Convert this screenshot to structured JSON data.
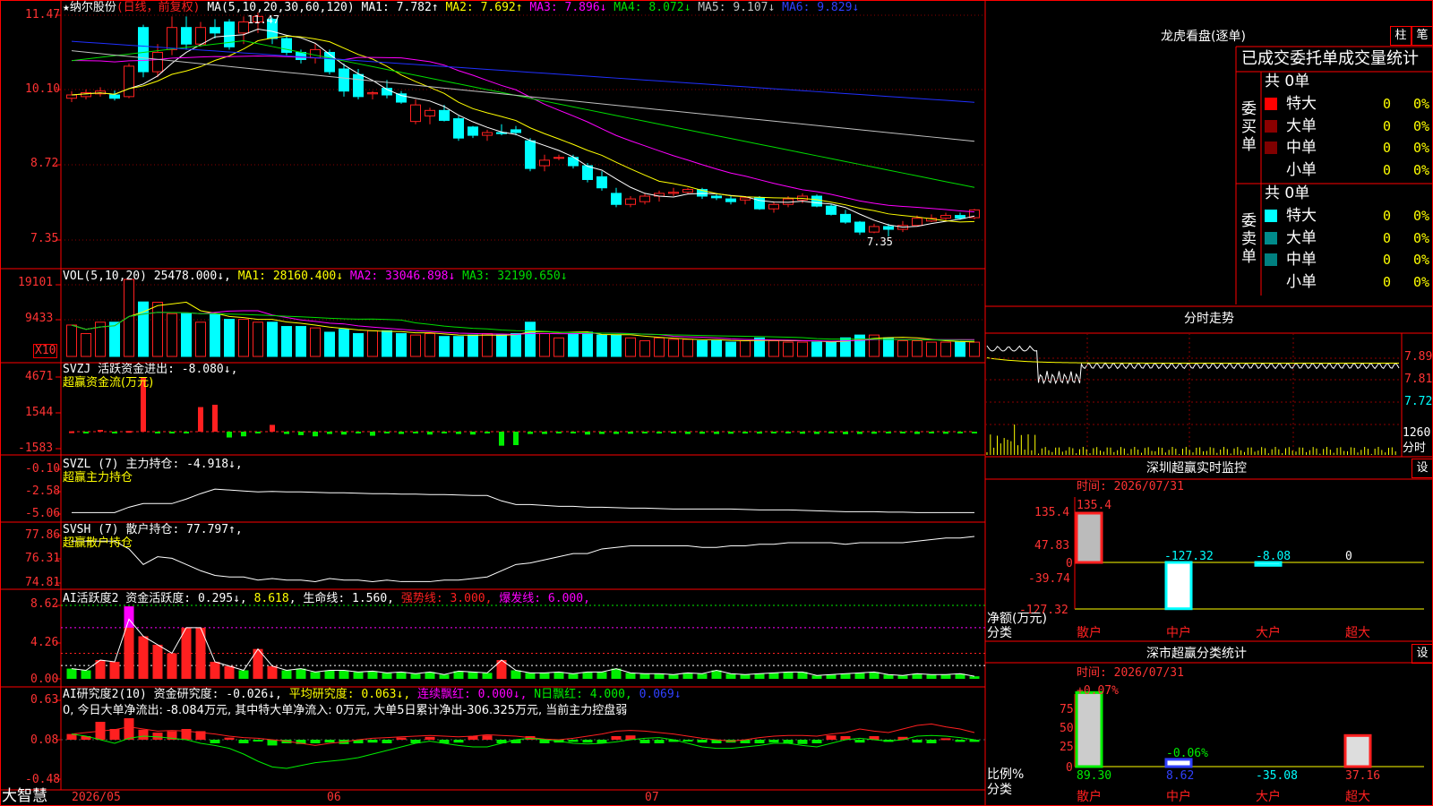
{
  "colors": {
    "up": "#ff2020",
    "down": "#00ffff",
    "ma1": "#ffffff",
    "ma2": "#ffff00",
    "ma3": "#ff00ff",
    "ma4": "#00dd00",
    "ma5": "#c0c0c0",
    "ma6": "#2030ff",
    "grid": "#8b0000",
    "frame": "#ff0000",
    "green": "#00ee00"
  },
  "header": {
    "star": "★",
    "stock_name": "纳尔股份",
    "period": "(日线，前复权)",
    "ma_params": "MA(5,10,20,30,60,120)",
    "ma1": "MA1: 7.782↑",
    "ma2": "MA2: 7.692↑",
    "ma3": "MA3: 7.896↓",
    "ma4": "MA4: 8.072↓",
    "ma5": "MA5: 9.107↓",
    "ma6": "MA6: 9.829↓"
  },
  "price_axis": [
    "11.47",
    "10.10",
    "8.72",
    "7.35"
  ],
  "price_marks": {
    "high": "11.47",
    "low": "7.35"
  },
  "vol": {
    "title": "VOL(5,10,20)",
    "value": "25478.000↓",
    "ma1": "MA1: 28160.400↓",
    "ma2": "MA2: 33046.898↓",
    "ma3": "MA3: 32190.650↓",
    "axis": [
      "19101",
      "9433"
    ],
    "unit": "X10"
  },
  "svzj": {
    "title": "SVZJ  活跃资金进出: -8.080↓,",
    "sub": "超赢资金流(万元)",
    "axis": [
      "4671",
      "1544",
      "-1583"
    ]
  },
  "svzl": {
    "title": "SVZL (7) 主力持仓: -4.918↓,",
    "sub": "超赢主力持仓",
    "axis": [
      "-0.10",
      "-2.58",
      "-5.06"
    ]
  },
  "svsh": {
    "title": "SVSH (7) 散户持仓: 77.797↑,",
    "sub": "超赢散户持仓",
    "axis": [
      "77.86",
      "76.31",
      "74.81"
    ]
  },
  "ai1": {
    "title": "AI活跃度2 资金活跃度: 0.295↓",
    "v2": "8.618",
    "life": "生命线: 1.560,",
    "strong": "强势线: 3.000,",
    "burst": "爆发线: 6.000,",
    "axis": [
      "8.62",
      "4.26",
      "0.00"
    ]
  },
  "ai2": {
    "title": "AI研究度2(10) 资金研究度: -0.026↓,",
    "avg": "平均研究度: 0.063↓,",
    "cont": "连续飘红: 0.000↓,",
    "nday": "N日飘红: 4.000,",
    "last": "0.069↓",
    "summary": "0, 今日大单净流出: -8.084万元, 其中特大单净流入: 0万元, 大单5日累计净出-306.325万元, 当前主力控盘弱",
    "axis": [
      "0.63",
      "0.08",
      "-0.48"
    ]
  },
  "date_axis": {
    "brand": "大智慧",
    "d1": "2026/05",
    "d2": "06",
    "d3": "07"
  },
  "chart_data": {
    "type": "candlestick",
    "title": "纳尔股份 (日线，前复权)",
    "ylim": [
      7.0,
      11.6
    ],
    "labels": {
      "high": 11.47,
      "low": 7.35
    },
    "ohlc": [
      [
        9.92,
        10.05,
        9.85,
        9.98
      ],
      [
        9.95,
        10.08,
        9.9,
        10.02
      ],
      [
        10.0,
        10.12,
        9.95,
        10.05
      ],
      [
        9.98,
        10.06,
        9.88,
        9.92
      ],
      [
        9.95,
        10.55,
        9.92,
        10.5
      ],
      [
        11.2,
        11.25,
        10.3,
        10.4
      ],
      [
        10.4,
        10.9,
        10.3,
        10.75
      ],
      [
        10.8,
        11.4,
        10.7,
        11.2
      ],
      [
        11.2,
        11.4,
        10.8,
        10.9
      ],
      [
        10.9,
        11.3,
        10.85,
        11.2
      ],
      [
        11.2,
        11.35,
        11.0,
        11.1
      ],
      [
        11.3,
        11.35,
        10.8,
        10.85
      ],
      [
        11.1,
        11.4,
        10.9,
        11.3
      ],
      [
        11.3,
        11.47,
        11.1,
        11.4
      ],
      [
        11.35,
        11.38,
        10.9,
        11.0
      ],
      [
        11.0,
        11.05,
        10.7,
        10.75
      ],
      [
        10.75,
        10.8,
        10.55,
        10.62
      ],
      [
        10.65,
        10.9,
        10.55,
        10.8
      ],
      [
        10.75,
        10.8,
        10.35,
        10.4
      ],
      [
        10.45,
        10.55,
        9.95,
        10.05
      ],
      [
        10.35,
        10.45,
        9.9,
        9.95
      ],
      [
        10.0,
        10.05,
        9.9,
        10.02
      ],
      [
        10.1,
        10.25,
        9.92,
        9.98
      ],
      [
        10.0,
        10.05,
        9.82,
        9.85
      ],
      [
        9.5,
        9.9,
        9.45,
        9.8
      ],
      [
        9.6,
        9.75,
        9.45,
        9.7
      ],
      [
        9.7,
        9.8,
        9.5,
        9.52
      ],
      [
        9.55,
        9.6,
        9.15,
        9.2
      ],
      [
        9.4,
        9.42,
        9.2,
        9.25
      ],
      [
        9.25,
        9.35,
        9.15,
        9.3
      ],
      [
        9.3,
        9.45,
        9.25,
        9.28
      ],
      [
        9.35,
        9.42,
        9.25,
        9.3
      ],
      [
        9.15,
        9.2,
        8.6,
        8.65
      ],
      [
        8.7,
        8.9,
        8.6,
        8.8
      ],
      [
        8.85,
        8.9,
        8.8,
        8.85
      ],
      [
        8.85,
        8.9,
        8.65,
        8.7
      ],
      [
        8.7,
        8.75,
        8.4,
        8.45
      ],
      [
        8.5,
        8.6,
        8.25,
        8.3
      ],
      [
        8.2,
        8.3,
        7.95,
        8.0
      ],
      [
        8.0,
        8.15,
        7.95,
        8.1
      ],
      [
        8.05,
        8.2,
        8.0,
        8.15
      ],
      [
        8.15,
        8.25,
        8.05,
        8.2
      ],
      [
        8.2,
        8.3,
        8.15,
        8.22
      ],
      [
        8.22,
        8.3,
        8.18,
        8.27
      ],
      [
        8.27,
        8.3,
        8.1,
        8.15
      ],
      [
        8.15,
        8.2,
        8.08,
        8.12
      ],
      [
        8.1,
        8.15,
        8.0,
        8.05
      ],
      [
        8.08,
        8.15,
        8.0,
        8.12
      ],
      [
        8.12,
        8.15,
        7.9,
        7.92
      ],
      [
        7.92,
        8.05,
        7.85,
        8.0
      ],
      [
        8.0,
        8.15,
        7.95,
        8.1
      ],
      [
        8.08,
        8.2,
        8.02,
        8.15
      ],
      [
        8.15,
        8.18,
        7.95,
        7.97
      ],
      [
        7.97,
        8.0,
        7.8,
        7.82
      ],
      [
        7.82,
        7.9,
        7.65,
        7.68
      ],
      [
        7.68,
        7.7,
        7.45,
        7.5
      ],
      [
        7.5,
        7.65,
        7.48,
        7.6
      ],
      [
        7.6,
        7.65,
        7.42,
        7.55
      ],
      [
        7.55,
        7.7,
        7.5,
        7.62
      ],
      [
        7.62,
        7.8,
        7.6,
        7.75
      ],
      [
        7.7,
        7.82,
        7.68,
        7.75
      ],
      [
        7.75,
        7.85,
        7.7,
        7.8
      ],
      [
        7.8,
        7.85,
        7.72,
        7.75
      ],
      [
        7.76,
        7.92,
        7.73,
        7.9
      ]
    ],
    "vol_x10": [
      11000,
      8000,
      12000,
      12000,
      27000,
      19100,
      19000,
      15000,
      15000,
      12000,
      15000,
      13000,
      13000,
      12000,
      12000,
      10500,
      10500,
      10000,
      8500,
      9500,
      8000,
      9000,
      9000,
      8000,
      7500,
      8000,
      7000,
      7000,
      7500,
      8000,
      7500,
      8000,
      12000,
      8000,
      6500,
      8000,
      8500,
      7500,
      7500,
      6500,
      5500,
      6500,
      6000,
      6000,
      5500,
      5500,
      5000,
      5500,
      6500,
      5500,
      5000,
      5000,
      5000,
      5000,
      6500,
      7500,
      7500,
      6500,
      5500,
      5500,
      5000,
      5000,
      5000,
      5000
    ],
    "fund_flow": [
      30,
      -30,
      150,
      -30,
      60,
      4600,
      -80,
      -30,
      -40,
      2100,
      2300,
      -500,
      -400,
      -150,
      580,
      -200,
      -300,
      -400,
      -200,
      -250,
      -150,
      -350,
      -150,
      -200,
      -150,
      -250,
      -100,
      -200,
      -250,
      -150,
      -1200,
      -1150,
      -200,
      -200,
      -150,
      -150,
      -250,
      -200,
      -200,
      -180,
      -150,
      -160,
      -150,
      -200,
      -180,
      -200,
      -180,
      -160,
      -170,
      -150,
      -150,
      -180,
      -200,
      -150,
      -220,
      -200,
      -180,
      -150,
      -150,
      -200,
      -150,
      -180,
      -150,
      -120
    ],
    "svzl": [
      -4.9,
      -4.9,
      -4.9,
      -4.9,
      -4.3,
      -3.9,
      -3.9,
      -3.9,
      -3.4,
      -2.8,
      -2.3,
      -2.4,
      -2.5,
      -2.6,
      -2.55,
      -2.6,
      -2.6,
      -2.65,
      -2.7,
      -2.7,
      -2.75,
      -2.8,
      -2.8,
      -2.85,
      -2.85,
      -2.9,
      -2.9,
      -2.95,
      -3.0,
      -3.0,
      -3.6,
      -4.0,
      -4.0,
      -4.1,
      -4.2,
      -4.2,
      -4.3,
      -4.3,
      -4.35,
      -4.4,
      -4.4,
      -4.45,
      -4.5,
      -4.5,
      -4.5,
      -4.5,
      -4.5,
      -4.55,
      -4.6,
      -4.6,
      -4.6,
      -4.65,
      -4.7,
      -4.75,
      -4.8,
      -4.8,
      -4.8,
      -4.85,
      -4.85,
      -4.9,
      -4.9,
      -4.9,
      -4.9,
      -4.9
    ],
    "svsh": [
      77.5,
      77.5,
      77.5,
      77.5,
      77.0,
      76.0,
      76.5,
      76.4,
      76.0,
      75.6,
      75.3,
      75.2,
      75.2,
      75.0,
      75.1,
      75.0,
      75.0,
      74.9,
      75.1,
      75.0,
      75.0,
      74.9,
      75.0,
      74.9,
      74.9,
      74.9,
      75.0,
      75.0,
      75.1,
      75.2,
      75.6,
      76.0,
      76.1,
      76.3,
      76.5,
      76.7,
      76.7,
      77.0,
      77.1,
      77.2,
      77.2,
      77.2,
      77.2,
      77.2,
      77.1,
      77.1,
      77.2,
      77.2,
      77.3,
      77.3,
      77.4,
      77.4,
      77.4,
      77.4,
      77.3,
      77.4,
      77.4,
      77.4,
      77.4,
      77.5,
      77.6,
      77.7,
      77.7,
      77.8
    ],
    "activity": [
      1.2,
      1.0,
      2.2,
      2.0,
      8.5,
      5.0,
      4.0,
      3.0,
      6.0,
      6.0,
      2.0,
      1.5,
      1.0,
      3.5,
      1.5,
      1.0,
      1.2,
      0.8,
      1.0,
      1.0,
      0.8,
      0.9,
      0.7,
      0.8,
      0.6,
      0.8,
      0.5,
      0.9,
      0.8,
      0.7,
      2.2,
      1.0,
      0.7,
      0.7,
      0.8,
      0.6,
      0.8,
      0.8,
      1.2,
      0.7,
      0.6,
      0.6,
      0.5,
      0.7,
      0.6,
      1.0,
      0.6,
      0.5,
      0.6,
      0.7,
      0.8,
      0.8,
      0.4,
      0.5,
      0.6,
      0.7,
      0.8,
      0.5,
      0.4,
      0.6,
      0.5,
      0.5,
      0.6,
      0.3
    ],
    "research": [
      0.08,
      0.05,
      0.25,
      0.15,
      0.3,
      0.14,
      0.1,
      0.12,
      0.15,
      0.12,
      -0.05,
      0.03,
      -0.05,
      -0.02,
      -0.08,
      -0.05,
      -0.06,
      -0.05,
      -0.04,
      -0.06,
      -0.05,
      -0.04,
      -0.05,
      0.03,
      -0.05,
      0.04,
      -0.05,
      -0.04,
      0.05,
      0.06,
      -0.05,
      -0.05,
      0.05,
      -0.05,
      -0.04,
      -0.03,
      -0.04,
      -0.05,
      0.05,
      0.06,
      -0.05,
      -0.05,
      -0.03,
      -0.02,
      -0.04,
      -0.05,
      -0.04,
      -0.05,
      -0.05,
      -0.04,
      -0.05,
      -0.06,
      -0.05,
      0.06,
      0.05,
      -0.04,
      0.05,
      -0.03,
      0.04,
      -0.04,
      -0.05,
      0.02,
      -0.03,
      -0.03
    ],
    "research_red_line": [
      0.08,
      0.1,
      0.12,
      0.14,
      0.18,
      0.15,
      0.12,
      0.13,
      0.12,
      0.1,
      0.08,
      0.05,
      0.03,
      0.02,
      0.0,
      -0.02,
      -0.05,
      -0.08,
      -0.05,
      -0.03,
      0.0,
      0.02,
      0.03,
      0.04,
      0.05,
      0.06,
      0.05,
      0.04,
      0.05,
      0.07,
      0.06,
      0.05,
      0.03,
      0.01,
      0.0,
      0.02,
      0.05,
      0.08,
      0.12,
      0.13,
      0.12,
      0.1,
      0.08,
      0.05,
      0.02,
      0.0,
      -0.02,
      0.0,
      0.03,
      0.05,
      0.06,
      0.06,
      0.05,
      0.08,
      0.1,
      0.15,
      0.12,
      0.1,
      0.15,
      0.2,
      0.22,
      0.18,
      0.15,
      0.1
    ],
    "research_green_line": [
      0.08,
      0.05,
      0.0,
      -0.05,
      0.02,
      0.05,
      0.04,
      0.02,
      0.0,
      -0.05,
      -0.08,
      -0.12,
      -0.2,
      -0.3,
      -0.38,
      -0.4,
      -0.36,
      -0.32,
      -0.3,
      -0.28,
      -0.25,
      -0.2,
      -0.15,
      -0.1,
      -0.05,
      -0.02,
      -0.05,
      -0.08,
      -0.1,
      -0.1,
      -0.05,
      0.0,
      0.02,
      0.0,
      -0.02,
      -0.05,
      -0.06,
      -0.05,
      -0.03,
      0.0,
      0.02,
      0.03,
      0.0,
      -0.05,
      -0.1,
      -0.12,
      -0.12,
      -0.1,
      -0.08,
      -0.05,
      -0.05,
      -0.08,
      -0.1,
      -0.05,
      0.0,
      0.02,
      0.0,
      -0.02,
      0.0,
      0.05,
      0.06,
      0.05,
      0.03,
      0.0
    ]
  },
  "right": {
    "lhb_title": "龙虎看盘(逐单)",
    "btn_bar": "柱",
    "btn_line": "笔",
    "tabs": "已成交委托单成交量统计",
    "buy_total": "共 0单",
    "buy_label": "委买单",
    "sell_total": "共 0单",
    "sell_label": "委卖单",
    "rows": [
      {
        "name": "特大",
        "val": "0",
        "pct": "0%"
      },
      {
        "name": "大单",
        "val": "0",
        "pct": "0%"
      },
      {
        "name": "中单",
        "val": "0",
        "pct": "0%"
      },
      {
        "name": "小单",
        "val": "0",
        "pct": "0%"
      }
    ],
    "buy_swatches": [
      "#ff0000",
      "#8b0000",
      "#800000",
      ""
    ],
    "sell_swatches": [
      "#00ffff",
      "#008b8b",
      "#008080",
      ""
    ],
    "fs_title": "分时走势",
    "fs_axis": [
      "7.89",
      "7.81",
      "7.72",
      "1260"
    ],
    "fs_unit": "分时",
    "mon_title": "深圳超赢实时监控",
    "mon_btn": "设",
    "mon_time": "时间: 2026/07/31",
    "mon_axis": [
      "135.4",
      "47.83",
      "0",
      "-39.74",
      "-127.32"
    ],
    "mon_vals": [
      "135.4",
      "-127.32",
      "-8.08",
      "0"
    ],
    "mon_unit": "净额(万元)",
    "mon_cat": "分类",
    "cats": [
      "散户",
      "中户",
      "大户",
      "超大"
    ],
    "cls_title": "深市超赢分类统计",
    "cls_btn": "设",
    "cls_time": "时间: 2026/07/31",
    "cls_axis": [
      "75",
      "50",
      "25",
      "0"
    ],
    "cls_top": [
      "+0.07%",
      "-0.06%"
    ],
    "cls_vals": [
      "89.30",
      "8.62",
      "-35.08",
      "37.16"
    ],
    "cls_unit": "比例%",
    "cls_cat": "分类"
  }
}
